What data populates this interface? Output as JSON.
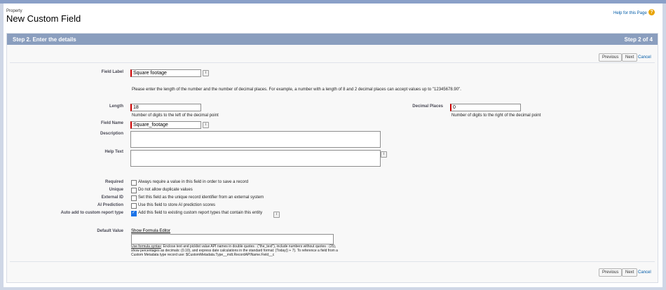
{
  "header": {
    "object_label": "Property",
    "title": "New Custom Field",
    "help_link": "Help for this Page",
    "help_icon": "?"
  },
  "step": {
    "title": "Step 2. Enter the details",
    "count": "Step 2 of 4"
  },
  "buttons": {
    "previous": "Previous",
    "next": "Next",
    "cancel": "Cancel"
  },
  "form": {
    "field_label": {
      "label": "Field Label",
      "value": "Square footage"
    },
    "intro": "Please enter the length of the number and the number of decimal places. For example, a number with a length of 8 and 2 decimal places can accept values up to \"12345678.90\".",
    "length": {
      "label": "Length",
      "value": "18",
      "hint": "Number of digits to the left of the decimal point"
    },
    "decimal_places": {
      "label": "Decimal Places",
      "value": "0",
      "hint": "Number of digits to the right of the decimal point"
    },
    "field_name": {
      "label": "Field Name",
      "value": "Square_footage"
    },
    "description": {
      "label": "Description",
      "value": ""
    },
    "help_text": {
      "label": "Help Text",
      "value": ""
    },
    "required": {
      "label": "Required",
      "text": "Always require a value in this field in order to save a record",
      "checked": false
    },
    "unique": {
      "label": "Unique",
      "text": "Do not allow duplicate values",
      "checked": false
    },
    "external_id": {
      "label": "External ID",
      "text": "Set this field as the unique record identifier from an external system",
      "checked": false
    },
    "ai_prediction": {
      "label": "AI Prediction",
      "text": "Use this field to store AI prediction scores",
      "checked": false
    },
    "auto_add": {
      "label": "Auto add to custom report type",
      "text": "Add this field to existing custom report types that contain this entity",
      "checked": true
    },
    "default_value": {
      "label": "Default Value",
      "formula_link": "Show Formula Editor",
      "hint_link": "Use formula syntax",
      "hint_text": ": Enclose text and picklist value API names in double quotes : (\"the_text\"), include numbers without quotes : (25), show percentages as decimals: (0.10), and express date calculations in the standard format: (Today() + 7). To reference a field from a Custom Metadata type record use: $CustomMetadata.Type__mdt.RecordAPIName.Field__c"
    }
  },
  "icons": {
    "info": "i"
  }
}
